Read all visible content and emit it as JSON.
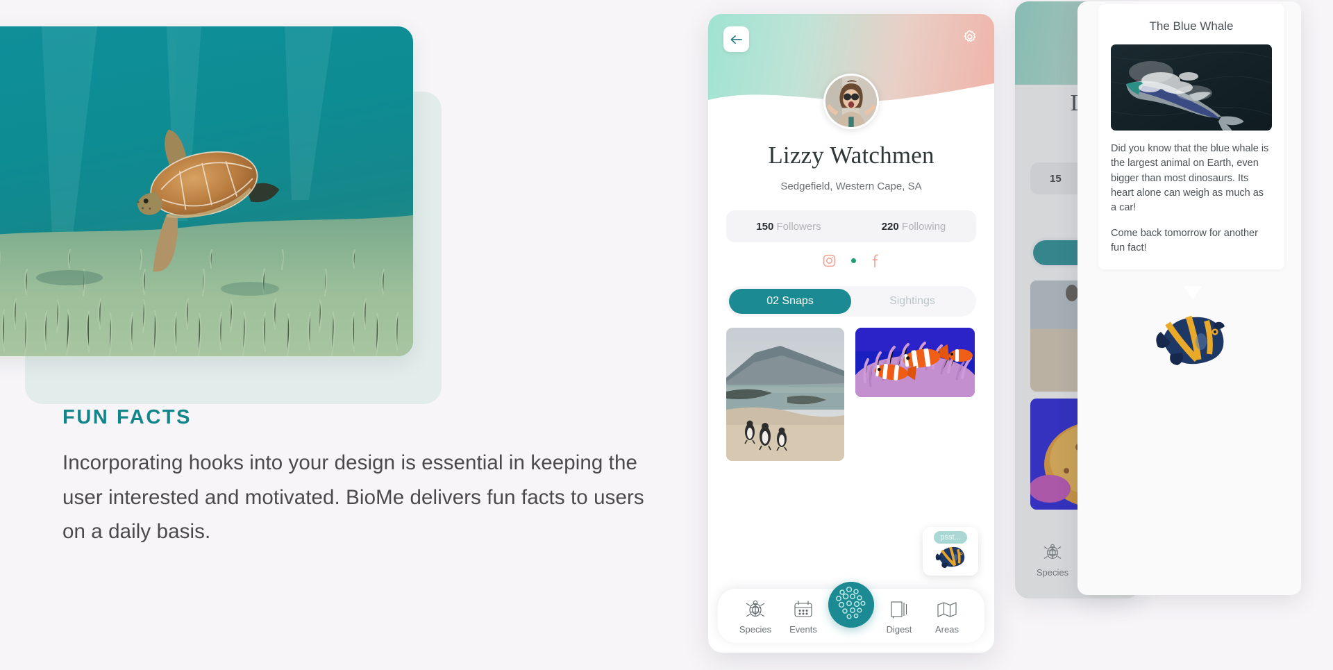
{
  "left_panel": {
    "kicker": "FUN FACTS",
    "body": "Incorporating hooks into your design is essential in keeping the user interested and motivated. BioMe delivers fun facts to users on a daily basis.",
    "hero_image_alt": "sea-turtle-swimming-over-seagrass"
  },
  "phone": {
    "back_icon": "back-arrow-icon",
    "settings_icon": "gear-icon",
    "avatar_alt": "profile-photo-woman-sunglasses",
    "name": "Lizzy Watchmen",
    "location": "Sedgefield, Western Cape, SA",
    "stats": [
      {
        "value": "150",
        "label": "Followers"
      },
      {
        "value": "220",
        "label": "Following"
      }
    ],
    "socials": [
      {
        "name": "instagram-icon"
      },
      {
        "name": "separator-dot"
      },
      {
        "name": "facebook-icon"
      }
    ],
    "tabs": [
      {
        "label": "02 Snaps",
        "active": true
      },
      {
        "label": "Sightings",
        "active": false
      }
    ],
    "gallery": [
      {
        "alt": "penguins-on-beach-photo"
      },
      {
        "alt": "clownfish-in-anemone-photo"
      }
    ],
    "psst": {
      "text": "psst...",
      "fish_alt": "angelfish-illustration"
    },
    "fab": {
      "name": "capture-button"
    },
    "nav": [
      {
        "label": "Species",
        "icon": "turtle-icon"
      },
      {
        "label": "Events",
        "icon": "calendar-icon"
      },
      {
        "label": "Digest",
        "icon": "book-icon"
      },
      {
        "label": "Areas",
        "icon": "map-icon"
      }
    ]
  },
  "phone_back": {
    "name_fragment": "L",
    "stat_fragment": "15",
    "nav_label": "Species"
  },
  "fact_card": {
    "title": "The Blue Whale",
    "photo_alt": "aerial-blue-whale-photo",
    "paragraphs": [
      "Did you know that the blue whale is the largest animal on Earth, even bigger than most dinosaurs. Its heart alone can weigh as much as a car!",
      "Come back tomorrow for another fun fact!"
    ],
    "fish_alt": "angelfish-illustration"
  },
  "colors": {
    "accent_teal": "#13868c",
    "tab_teal": "#1b8a92",
    "page_bg": "#f7f5f7",
    "card_mint": "#e2ecea",
    "social_pink": "#ee9a8c",
    "dot_green": "#1f9d73"
  }
}
